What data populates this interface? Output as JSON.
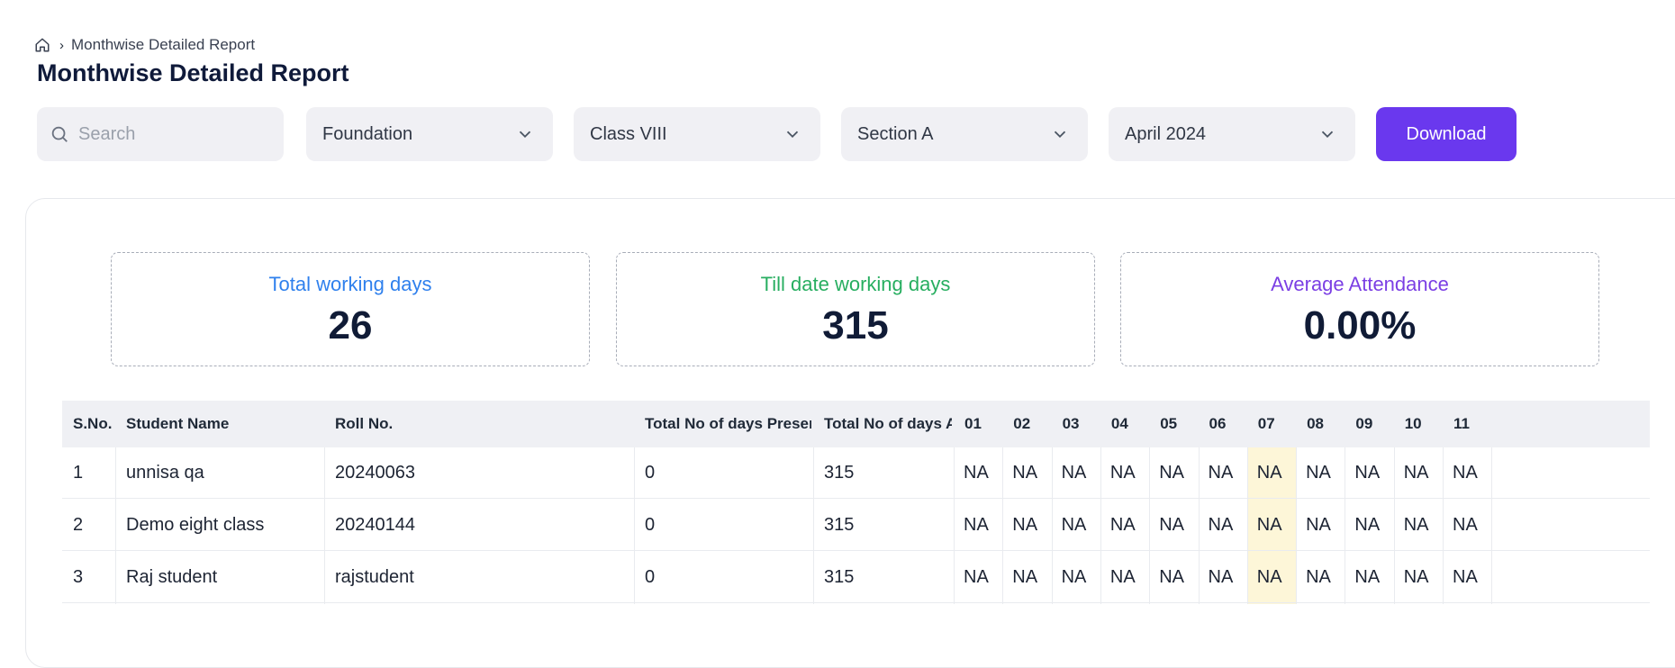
{
  "breadcrumb": {
    "current": "Monthwise Detailed Report"
  },
  "page": {
    "title": "Monthwise Detailed Report"
  },
  "filters": {
    "search_placeholder": "Search",
    "program": "Foundation",
    "class": "Class VIII",
    "section": "Section A",
    "month": "April 2024",
    "download_label": "Download"
  },
  "stats": [
    {
      "label": "Total working days",
      "value": "26",
      "color": "#2f80ed"
    },
    {
      "label": "Till date working days",
      "value": "315",
      "color": "#27ae60"
    },
    {
      "label": "Average Attendance",
      "value": "0.00%",
      "color": "#7b3fe4"
    }
  ],
  "table": {
    "headers": [
      "S.No.",
      "Student Name",
      "Roll No.",
      "Total No of days Present",
      "Total No of days Absent"
    ],
    "day_headers": [
      "01",
      "02",
      "03",
      "04",
      "05",
      "06",
      "07",
      "08",
      "09",
      "10",
      "11"
    ],
    "highlight_day_index": 6,
    "highlight_color": "#fdf6d8",
    "rows": [
      {
        "sno": "1",
        "name": "unnisa qa",
        "roll": "20240063",
        "present": "0",
        "absent": "315",
        "days": [
          "NA",
          "NA",
          "NA",
          "NA",
          "NA",
          "NA",
          "NA",
          "NA",
          "NA",
          "NA",
          "NA"
        ]
      },
      {
        "sno": "2",
        "name": "Demo eight class",
        "roll": "20240144",
        "present": "0",
        "absent": "315",
        "days": [
          "NA",
          "NA",
          "NA",
          "NA",
          "NA",
          "NA",
          "NA",
          "NA",
          "NA",
          "NA",
          "NA"
        ]
      },
      {
        "sno": "3",
        "name": "Raj student",
        "roll": "rajstudent",
        "present": "0",
        "absent": "315",
        "days": [
          "NA",
          "NA",
          "NA",
          "NA",
          "NA",
          "NA",
          "NA",
          "NA",
          "NA",
          "NA",
          "NA"
        ]
      }
    ]
  },
  "accent_color": "#6a38ee"
}
